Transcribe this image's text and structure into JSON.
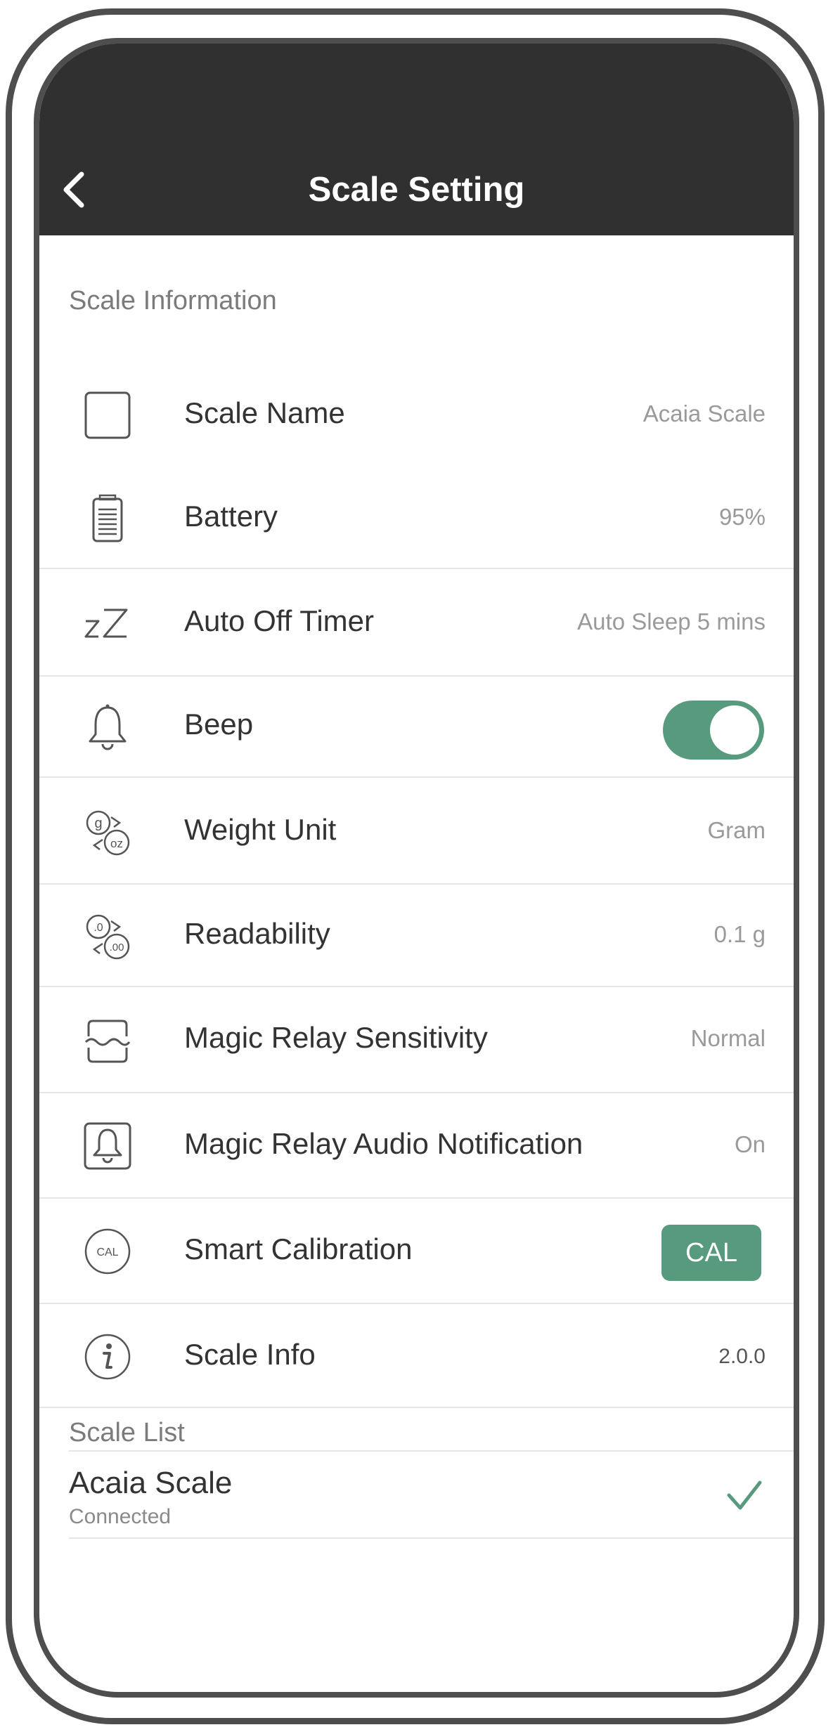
{
  "header": {
    "title": "Scale Setting"
  },
  "sections": {
    "info_label": "Scale Information",
    "list_label": "Scale List"
  },
  "rows": [
    {
      "label": "Scale Name",
      "value": "Acaia Scale",
      "icon": "square-icon"
    },
    {
      "label": "Battery",
      "value": "95%",
      "icon": "battery-icon"
    },
    {
      "label": "Auto Off Timer",
      "value": "Auto Sleep 5 mins",
      "icon": "sleep-zz-icon"
    },
    {
      "label": "Beep",
      "toggle_on": true,
      "icon": "bell-icon"
    },
    {
      "label": "Weight Unit",
      "value": "Gram",
      "icon": "unit-switch-icon"
    },
    {
      "label": "Readability",
      "value": "0.1 g",
      "icon": "readability-icon"
    },
    {
      "label": "Magic Relay Sensitivity",
      "value": "Normal",
      "icon": "relay-sensitivity-icon"
    },
    {
      "label": "Magic Relay Audio Notification",
      "value": "On",
      "icon": "bell-box-icon"
    },
    {
      "label": "Smart Calibration",
      "button": "CAL",
      "icon": "cal-circle-icon",
      "icon_text": "CAL"
    },
    {
      "label": "Scale Info",
      "value": "2.0.0",
      "icon": "info-icon"
    }
  ],
  "scale_list": [
    {
      "name": "Acaia Scale",
      "status": "Connected",
      "selected": true
    }
  ],
  "colors": {
    "header": "#303030",
    "accent": "#589a7d",
    "value_text": "#9a9a9a"
  }
}
